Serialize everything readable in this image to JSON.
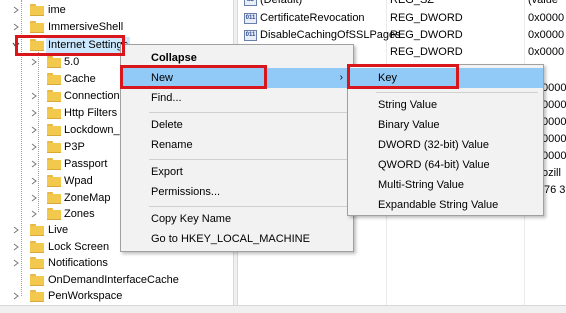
{
  "tree": {
    "items": [
      {
        "label": "ime",
        "indent": 1,
        "expanded": false,
        "selected": false
      },
      {
        "label": "ImmersiveShell",
        "indent": 1,
        "expanded": false,
        "selected": false
      },
      {
        "label": "Internet Settings",
        "indent": 1,
        "expanded": true,
        "selected": true
      },
      {
        "label": "5.0",
        "indent": 2,
        "expanded": false,
        "selected": false
      },
      {
        "label": "Cache",
        "indent": 2,
        "expanded": false,
        "selected": false
      },
      {
        "label": "Connections",
        "indent": 2,
        "expanded": false,
        "selected": false
      },
      {
        "label": "Http Filters",
        "indent": 2,
        "expanded": false,
        "selected": false
      },
      {
        "label": "Lockdown_Zones",
        "indent": 2,
        "expanded": false,
        "selected": false
      },
      {
        "label": "P3P",
        "indent": 2,
        "expanded": false,
        "selected": false
      },
      {
        "label": "Passport",
        "indent": 2,
        "expanded": false,
        "selected": false
      },
      {
        "label": "Wpad",
        "indent": 2,
        "expanded": false,
        "selected": false
      },
      {
        "label": "ZoneMap",
        "indent": 2,
        "expanded": false,
        "selected": false
      },
      {
        "label": "Zones",
        "indent": 2,
        "expanded": false,
        "selected": false
      },
      {
        "label": "Live",
        "indent": 1,
        "expanded": false,
        "selected": false
      },
      {
        "label": "Lock Screen",
        "indent": 1,
        "expanded": false,
        "selected": false
      },
      {
        "label": "Notifications",
        "indent": 1,
        "expanded": false,
        "selected": false
      },
      {
        "label": "OnDemandInterfaceCache",
        "indent": 1,
        "expanded": false,
        "selected": false
      },
      {
        "label": "PenWorkspace",
        "indent": 1,
        "expanded": false,
        "selected": false
      }
    ]
  },
  "values": {
    "rows": [
      {
        "name": "(Default)",
        "type": "REG_SZ",
        "data": "(value"
      },
      {
        "name": "CertificateRevocation",
        "type": "REG_DWORD",
        "data": "0x0000"
      },
      {
        "name": "DisableCachingOfSSLPages",
        "type": "REG_DWORD",
        "data": "0x0000"
      },
      {
        "name": "",
        "type": "REG_DWORD",
        "data": "0x0000"
      },
      {
        "name": "",
        "type": "",
        "data": ""
      },
      {
        "name": "",
        "type": "",
        "data": "0000"
      },
      {
        "name": "",
        "type": "",
        "data": "0000"
      },
      {
        "name": "",
        "type": "",
        "data": "0000"
      },
      {
        "name": "",
        "type": "",
        "data": "0000"
      },
      {
        "name": "",
        "type": "",
        "data": "0000"
      },
      {
        "name": "",
        "type": "",
        "data": "ozill"
      },
      {
        "name": "",
        "type": "",
        "data": "76 3"
      }
    ],
    "icon_text": "ab"
  },
  "context_menu": {
    "items": [
      {
        "label": "Collapse",
        "bold": true
      },
      {
        "label": "New",
        "highlighted": true,
        "has_submenu": true
      },
      {
        "label": "Find..."
      },
      {
        "label": "Delete"
      },
      {
        "label": "Rename"
      },
      {
        "label": "Export"
      },
      {
        "label": "Permissions..."
      },
      {
        "label": "Copy Key Name"
      },
      {
        "label": "Go to HKEY_LOCAL_MACHINE"
      }
    ],
    "submenu_arrow": "›"
  },
  "submenu": {
    "items": [
      {
        "label": "Key",
        "highlighted": true
      },
      {
        "label": "String Value"
      },
      {
        "label": "Binary Value"
      },
      {
        "label": "DWORD (32-bit) Value"
      },
      {
        "label": "QWORD (64-bit) Value"
      },
      {
        "label": "Multi-String Value"
      },
      {
        "label": "Expandable String Value"
      }
    ]
  },
  "colors": {
    "highlight": "#91c9f7",
    "annotation": "#d9161c",
    "folder": "#f2c94c",
    "menu_bg": "#f2f2f2"
  }
}
